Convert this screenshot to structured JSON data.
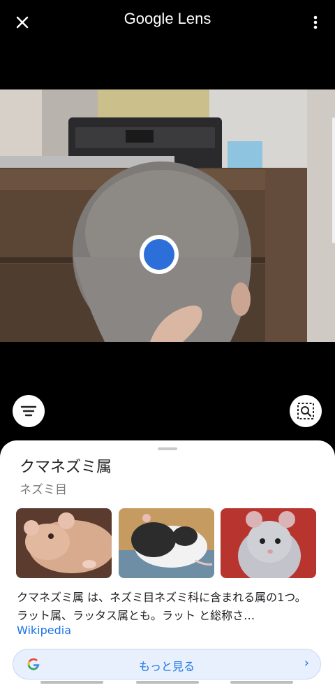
{
  "header": {
    "title": "Google Lens"
  },
  "icons": {
    "close": "close-icon",
    "more": "more-vert-icon",
    "filter": "filter-icon",
    "lens": "search-region-icon",
    "google": "google-g-icon",
    "chevron": "chevron-right-icon"
  },
  "colors": {
    "accent": "#1a73e8",
    "shutter": "#2d6fd8",
    "sheet_bg": "#ffffff"
  },
  "result": {
    "title": "クマネズミ属",
    "subtitle": "ネズミ目",
    "description": "クマネズミ属 は、ネズミ目ネズミ科に含まれる属の1つ。ラット属、ラッタス属とも。ラット と総称さ…",
    "source": "Wikipedia",
    "more_button": "もっと見る",
    "chevron": "›"
  }
}
